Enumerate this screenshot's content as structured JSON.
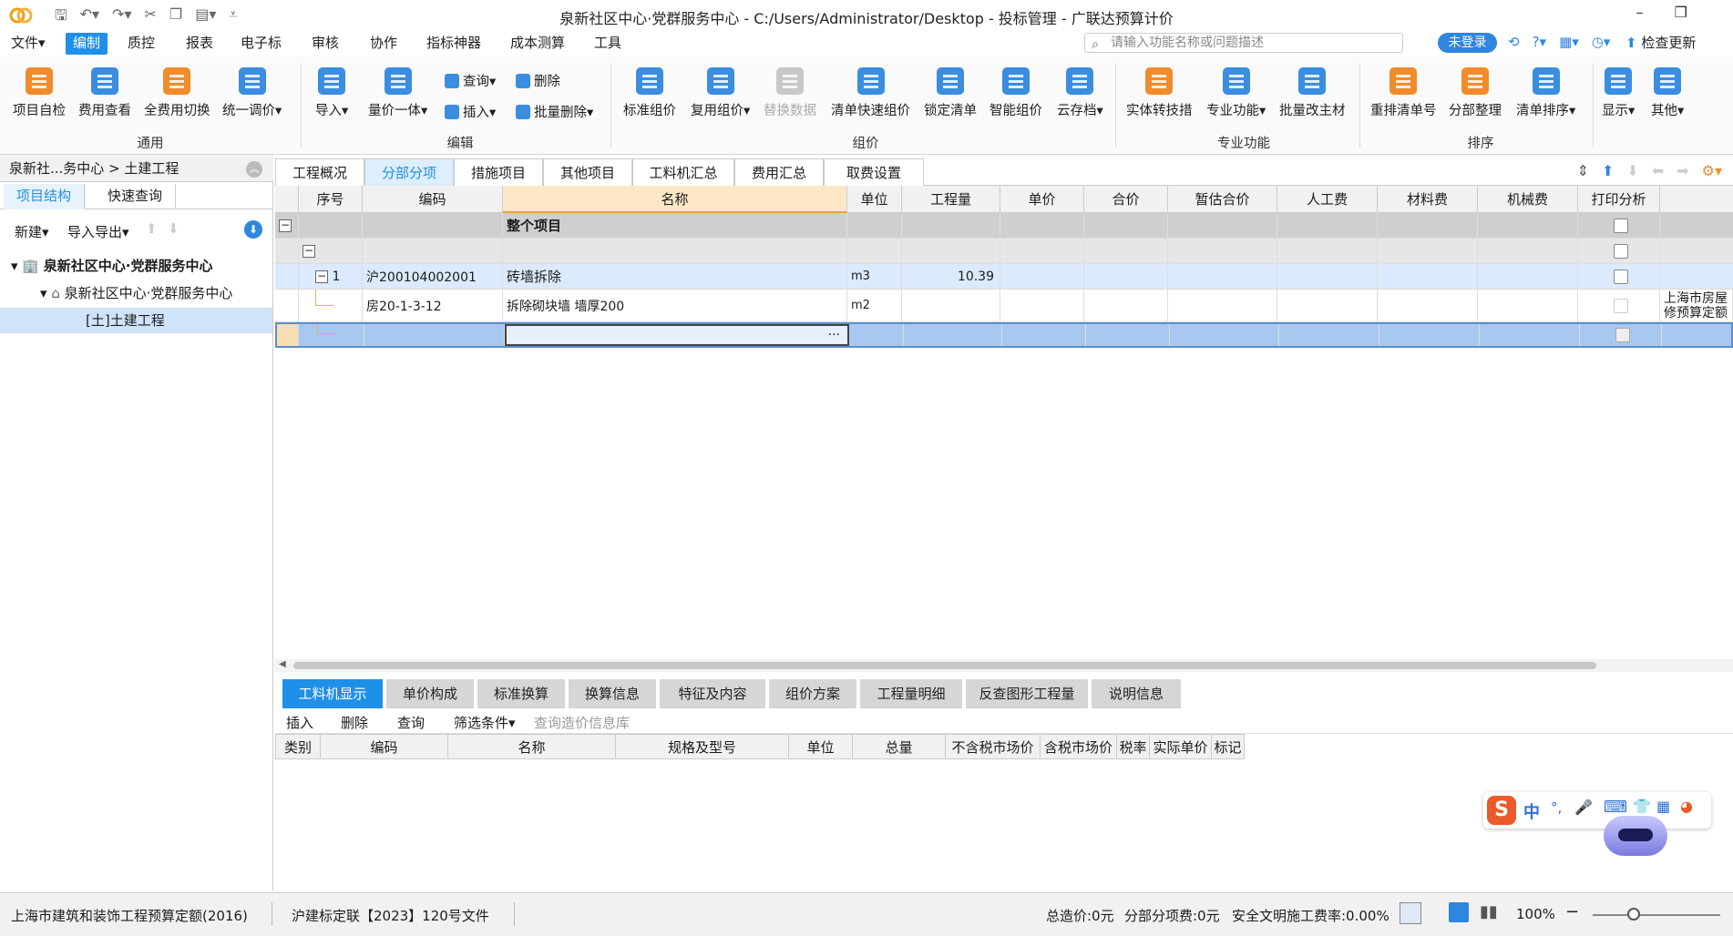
{
  "window": {
    "title": "泉新社区中心·党群服务中心 - C:/Users/Administrator/Desktop - 投标管理 - 广联达预算计价",
    "minimize": "–",
    "restore": "❐",
    "close": ""
  },
  "menu": [
    "文件▾",
    "编制",
    "质控",
    "报表",
    "电子标",
    "审核",
    "协作",
    "指标神器",
    "成本测算",
    "工具"
  ],
  "search": {
    "placeholder": "请输入功能名称或问题描述"
  },
  "login_label": "未登录",
  "check_update": "检查更新",
  "ribbon": {
    "general": {
      "group": "通用",
      "items": [
        "项目自检",
        "费用查看",
        "全费用切换",
        "统一调价▾"
      ]
    },
    "edit": {
      "group": "编辑",
      "items": [
        "导入▾",
        "量价一体▾"
      ],
      "small": [
        "查询▾",
        "删除",
        "插入▾",
        "批量删除▾"
      ]
    },
    "pricing": {
      "group": "组价",
      "items": [
        "标准组价",
        "复用组价▾",
        "替换数据",
        "清单快速组价",
        "锁定清单",
        "智能组价",
        "云存档▾"
      ]
    },
    "special": {
      "group": "专业功能",
      "items": [
        "实体转技措",
        "专业功能▾",
        "批量改主材"
      ]
    },
    "sort": {
      "group": "排序",
      "items": [
        "重排清单号",
        "分部整理",
        "清单排序▾"
      ]
    },
    "other": {
      "items": [
        "显示▾",
        "其他▾"
      ]
    }
  },
  "left": {
    "breadcrumb": "泉新社...务中心 > 土建工程",
    "tabs": [
      "项目结构",
      "快速查询"
    ],
    "tools": [
      "新建▾",
      "导入导出▾"
    ],
    "tree": [
      "泉新社区中心·党群服务中心",
      "泉新社区中心·党群服务中心",
      "[土]土建工程"
    ]
  },
  "main_tabs": [
    "工程概况",
    "分部分项",
    "措施项目",
    "其他项目",
    "工料机汇总",
    "费用汇总",
    "取费设置"
  ],
  "grid": {
    "columns": [
      "序号",
      "编码",
      "名称",
      "单位",
      "工程量",
      "单价",
      "合价",
      "暂估合价",
      "人工费",
      "材料费",
      "机械费",
      "打印分析"
    ],
    "rows": [
      {
        "seq": "",
        "code": "",
        "name": "整个项目",
        "unit": "",
        "qty": "",
        "extra": ""
      },
      {
        "seq": "",
        "code": "",
        "name": "",
        "unit": "",
        "qty": "",
        "extra": ""
      },
      {
        "seq": "1",
        "code": "沪200104002001",
        "name": "砖墙拆除",
        "unit": "m3",
        "qty": "10.39",
        "extra": ""
      },
      {
        "seq": "",
        "code": "房20-1-3-12",
        "name": "拆除砌块墙 墙厚200",
        "unit": "m2",
        "qty": "",
        "extra": "上海市房屋修预算定额"
      },
      {
        "seq": "",
        "code": "",
        "name": "",
        "unit": "",
        "qty": "",
        "extra": ""
      }
    ],
    "ellipsis": "···"
  },
  "bottom_tabs": [
    "工料机显示",
    "单价构成",
    "标准换算",
    "换算信息",
    "特征及内容",
    "组价方案",
    "工程量明细",
    "反查图形工程量",
    "说明信息"
  ],
  "bottom_tools": [
    "插入",
    "删除",
    "查询",
    "筛选条件▾",
    "查询造价信息库"
  ],
  "bottom_columns": [
    "类别",
    "编码",
    "名称",
    "规格及型号",
    "单位",
    "总量",
    "不含税市场价",
    "含税市场价",
    "税率",
    "实际单价",
    "标记"
  ],
  "ime": [
    "中",
    "°,",
    "🎤",
    "⌨"
  ],
  "status": {
    "quota": "上海市建筑和装饰工程预算定额(2016)",
    "doc": "沪建标定联【2023】120号文件",
    "total": "总造价:0元",
    "subtotal": "分部分项费:0元",
    "safety": "安全文明施工费率:0.00%",
    "zoom": "100%"
  },
  "colors": {
    "accent": "#1e90e8",
    "login": "#2e86de",
    "name_header": "#fde7c7",
    "selected_row": "#dbeafc"
  }
}
